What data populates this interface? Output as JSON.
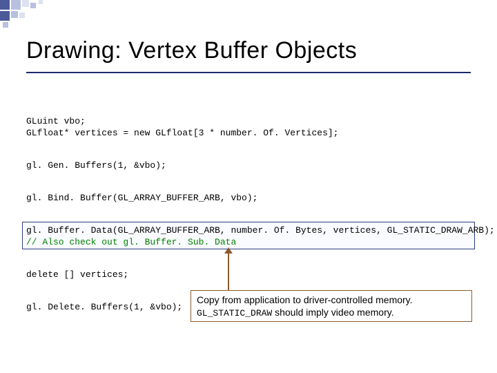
{
  "title": "Drawing:  Vertex Buffer Objects",
  "code": {
    "line1": "GLuint vbo;",
    "line2": "GLfloat* vertices = new GLfloat[3 * number. Of. Vertices];",
    "line3": "gl. Gen. Buffers(1, &vbo);",
    "line4": "gl. Bind. Buffer(GL_ARRAY_BUFFER_ARB, vbo);",
    "line5": "gl. Buffer. Data(GL_ARRAY_BUFFER_ARB, number. Of. Bytes, vertices, GL_STATIC_DRAW_ARB);",
    "line6": "// Also check out gl. Buffer. Sub. Data",
    "line7": "delete [] vertices;",
    "line8": "gl. Delete. Buffers(1, &vbo);"
  },
  "callout": {
    "text1": "Copy from application to driver-controlled memory.",
    "mono": "GL_STATIC_DRAW",
    "text2": " should imply video memory."
  }
}
